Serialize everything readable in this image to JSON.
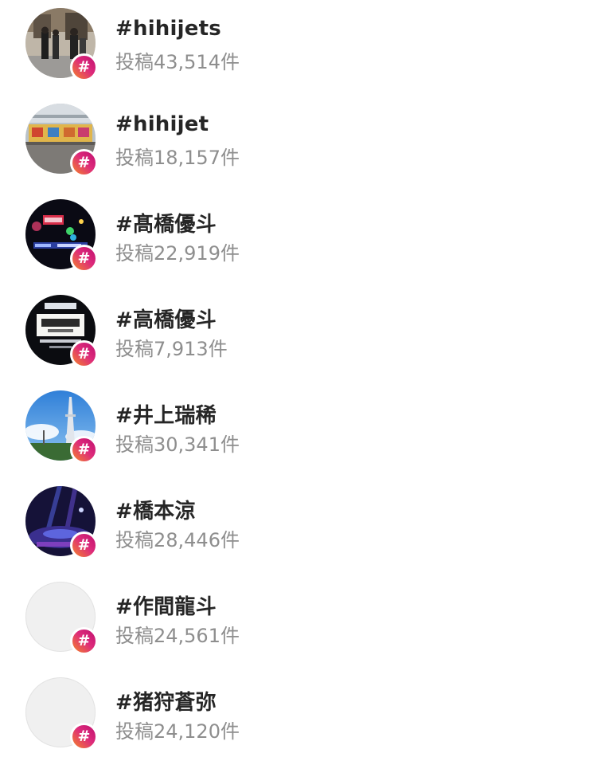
{
  "hashtag_results": [
    {
      "tag": "#hihijets",
      "posts": "投稿43,514件",
      "thumbnail": "photo"
    },
    {
      "tag": "#hihijet",
      "posts": "投稿18,157件",
      "thumbnail": "photo"
    },
    {
      "tag": "#髙橋優斗",
      "posts": "投稿22,919件",
      "thumbnail": "photo"
    },
    {
      "tag": "#高橋優斗",
      "posts": "投稿7,913件",
      "thumbnail": "photo"
    },
    {
      "tag": "#井上瑞稀",
      "posts": "投稿30,341件",
      "thumbnail": "photo"
    },
    {
      "tag": "#橋本涼",
      "posts": "投稿28,446件",
      "thumbnail": "photo"
    },
    {
      "tag": "#作間龍斗",
      "posts": "投稿24,561件",
      "thumbnail": "placeholder"
    },
    {
      "tag": "#猪狩蒼弥",
      "posts": "投稿24,120件",
      "thumbnail": "placeholder"
    }
  ],
  "badge_symbol": "#",
  "colors": {
    "tag_text": "#262626",
    "count_text": "#8e8e8e",
    "badge_gradient_start": "#f58529",
    "badge_gradient_end": "#c0116f",
    "placeholder": "#f0f0f0"
  }
}
